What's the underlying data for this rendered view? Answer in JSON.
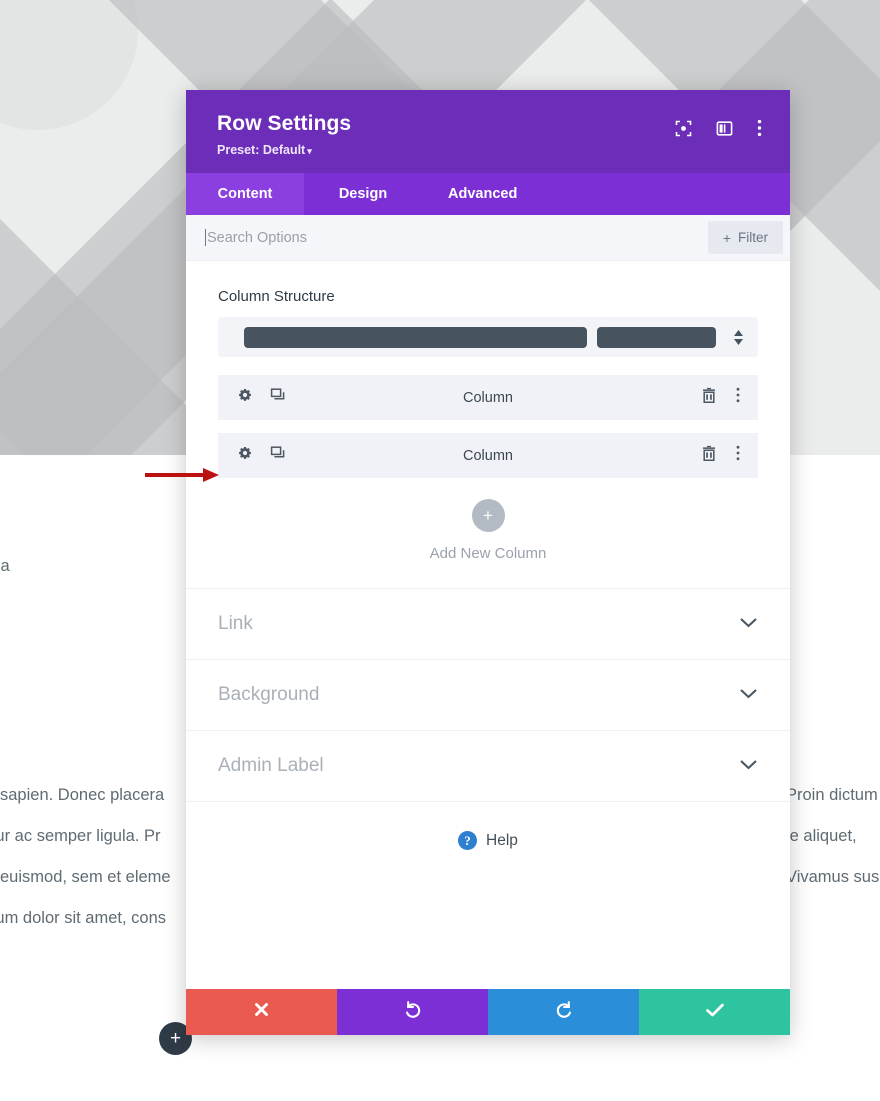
{
  "background": {
    "text_left_fragment": "ssa",
    "body_left_lines": "us sapien. Donec placera\nbitur ac semper ligula. Pr\nec euismod, sem et eleme\nosum dolor sit amet, cons",
    "body_right_lines": "Proin dictum\nie aliquet,\nVivamus sus",
    "add_button_label": "+"
  },
  "modal": {
    "title": "Row Settings",
    "preset_label": "Preset: Default",
    "preset_caret": "▾",
    "header_icons": [
      {
        "name": "focus-target-icon"
      },
      {
        "name": "panel-layout-icon"
      },
      {
        "name": "overflow-menu-icon"
      }
    ],
    "tabs": [
      {
        "label": "Content",
        "active": true
      },
      {
        "label": "Design",
        "active": false
      },
      {
        "label": "Advanced",
        "active": false
      }
    ],
    "search": {
      "value": "",
      "placeholder": "Search Options"
    },
    "filter_button": {
      "plus": "+",
      "label": "Filter"
    },
    "column_structure": {
      "label": "Column Structure",
      "bars": [
        {
          "ratio": "2.88"
        },
        {
          "ratio": "1"
        }
      ]
    },
    "columns": [
      {
        "label": "Column"
      },
      {
        "label": "Column"
      }
    ],
    "add_column": {
      "button_label": "+",
      "label": "Add New Column"
    },
    "accordions": [
      {
        "label": "Link"
      },
      {
        "label": "Background"
      },
      {
        "label": "Admin Label"
      }
    ],
    "help": {
      "icon_glyph": "?",
      "label": "Help"
    },
    "footer_buttons": [
      {
        "name": "cancel-button",
        "color": "#ea5a51"
      },
      {
        "name": "undo-button",
        "color": "#7b2fd4"
      },
      {
        "name": "redo-button",
        "color": "#2a8fd8"
      },
      {
        "name": "save-button",
        "color": "#2ec4a0"
      }
    ]
  },
  "annotation": {
    "arrow_color": "#bb1111"
  },
  "colors": {
    "header_purple": "#6c2eb9",
    "tabs_purple": "#7b2fd4",
    "active_tab_purple": "#8b3fe0",
    "row_gray": "#f0f2f7",
    "struct_bar": "#47545f"
  }
}
